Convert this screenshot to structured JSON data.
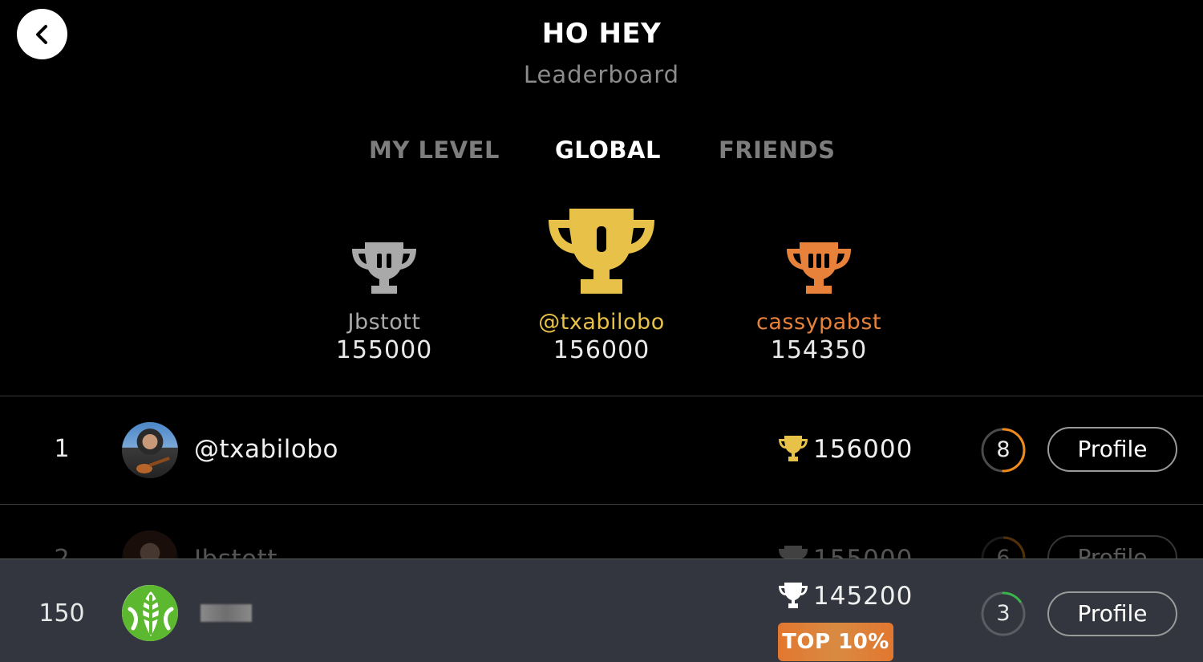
{
  "header": {
    "title": "HO HEY",
    "subtitle": "Leaderboard"
  },
  "tabs": [
    {
      "label": "MY LEVEL",
      "active": false
    },
    {
      "label": "GLOBAL",
      "active": true
    },
    {
      "label": "FRIENDS",
      "active": false
    }
  ],
  "podium": {
    "second": {
      "name": "Jbstott",
      "score": "155000",
      "color": "#a9a9a9",
      "mark": "II"
    },
    "first": {
      "name": "@txabilobo",
      "score": "156000",
      "color": "#e8c149",
      "mark": "I"
    },
    "third": {
      "name": "cassypabst",
      "score": "154350",
      "color": "#e8823a",
      "mark": "III"
    }
  },
  "rows": [
    {
      "rank": "1",
      "username": "@txabilobo",
      "score": "156000",
      "level": "8",
      "profile_label": "Profile",
      "level_progress": 0.5
    },
    {
      "rank": "2",
      "username": "Jbstott",
      "score": "155000",
      "level": "6",
      "profile_label": "Profile"
    }
  ],
  "current_user": {
    "rank": "150",
    "score": "145200",
    "level": "3",
    "level_progress": 0.15,
    "profile_label": "Profile",
    "badge": "TOP 10%"
  },
  "colors": {
    "gold": "#e8c149",
    "silver": "#a9a9a9",
    "bronze": "#e8823a",
    "ring_orange": "#f08a1c",
    "ring_green": "#39b54a"
  }
}
